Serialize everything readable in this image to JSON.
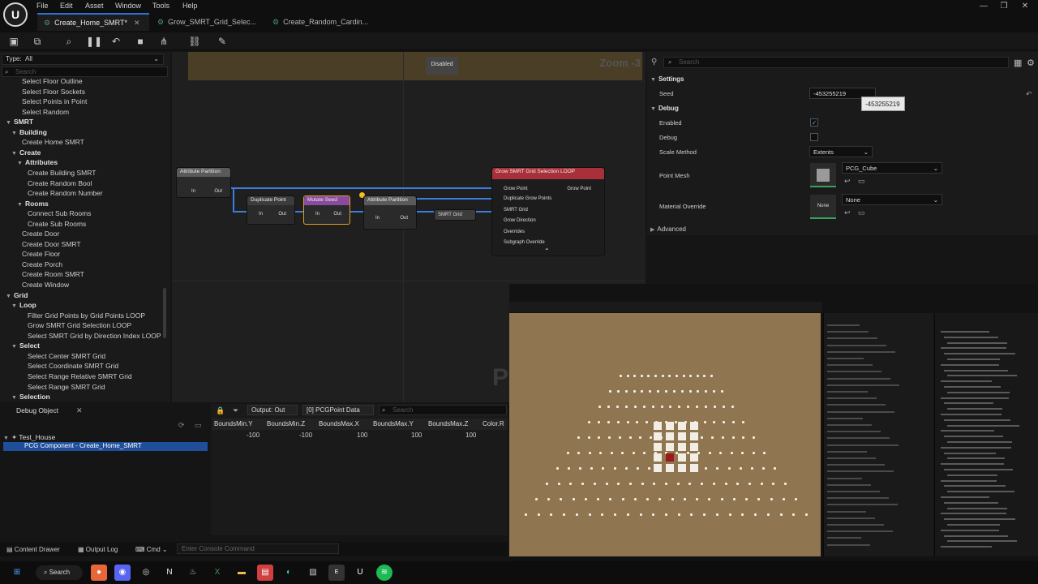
{
  "menu": [
    "File",
    "Edit",
    "Asset",
    "Window",
    "Tools",
    "Help"
  ],
  "tabs": [
    {
      "label": "Create_Home_SMRT*",
      "active": true
    },
    {
      "label": "Grow_SMRT_Grid_Selec..."
    },
    {
      "label": "Create_Random_Cardin..."
    }
  ],
  "left": {
    "type_label": "Type:",
    "type_value": "All",
    "search_placeholder": "Search",
    "items": [
      {
        "t": "Select Floor Outline",
        "lvl": 2
      },
      {
        "t": "Select Floor Sockets",
        "lvl": 2
      },
      {
        "t": "Select Points in Point",
        "lvl": 2
      },
      {
        "t": "Select Random",
        "lvl": 2
      },
      {
        "t": "SMRT",
        "lvl": 0,
        "h": true
      },
      {
        "t": "Building",
        "lvl": 1,
        "h": true
      },
      {
        "t": "Create Home SMRT",
        "lvl": 2
      },
      {
        "t": "Create",
        "lvl": 1,
        "h": true
      },
      {
        "t": "Attributes",
        "lvl": 2,
        "h": true
      },
      {
        "t": "Create Building SMRT",
        "lvl": 3
      },
      {
        "t": "Create Random Bool",
        "lvl": 3
      },
      {
        "t": "Create Random Number",
        "lvl": 3
      },
      {
        "t": "Rooms",
        "lvl": 2,
        "h": true
      },
      {
        "t": "Connect Sub Rooms",
        "lvl": 3
      },
      {
        "t": "Create Sub Rooms",
        "lvl": 3
      },
      {
        "t": "Create Door",
        "lvl": 2
      },
      {
        "t": "Create Door SMRT",
        "lvl": 2
      },
      {
        "t": "Create Floor",
        "lvl": 2
      },
      {
        "t": "Create Porch",
        "lvl": 2
      },
      {
        "t": "Create Room SMRT",
        "lvl": 2
      },
      {
        "t": "Create Window",
        "lvl": 2
      },
      {
        "t": "Grid",
        "lvl": 0,
        "h": true
      },
      {
        "t": "Loop",
        "lvl": 1,
        "h": true
      },
      {
        "t": "Filter Grid Points by Grid Points LOOP",
        "lvl": 3
      },
      {
        "t": "Grow SMRT Grid Selection LOOP",
        "lvl": 3
      },
      {
        "t": "Select SMRT Grid by Direction Index LOOP",
        "lvl": 3
      },
      {
        "t": "Select",
        "lvl": 1,
        "h": true
      },
      {
        "t": "Select Center SMRT Grid",
        "lvl": 3
      },
      {
        "t": "Select Coordinate SMRT Grid",
        "lvl": 3
      },
      {
        "t": "Select Range Relative SMRT Grid",
        "lvl": 3
      },
      {
        "t": "Select Range SMRT Grid",
        "lvl": 3
      },
      {
        "t": "Selection",
        "lvl": 1,
        "h": true
      }
    ]
  },
  "graph": {
    "zoom": "Zoom -3",
    "disabled_label": "Disabled",
    "nodes": {
      "attr1": "Attribute Partition",
      "dup": "Duplicate Point",
      "mutate": "Mutate Seed",
      "attr2": "Attribute Partition",
      "smrt": "SMRT Grid",
      "grow": "Grow SMRT Grid Selection LOOP",
      "pin_in": "In",
      "pin_out": "Out",
      "grow_pins": [
        "Grow Point",
        "Duplicate Grow Points",
        "SMRT Grid",
        "Grow Direction",
        "Overrides",
        "Subgraph Override"
      ],
      "grow_out": "Grow Point"
    }
  },
  "details": {
    "search_placeholder": "Search",
    "settings": "Settings",
    "seed_label": "Seed",
    "seed_value": "-453255219",
    "seed_tooltip": "-453255219",
    "debug_section": "Debug",
    "enabled": "Enabled",
    "debug": "Debug",
    "scale_method": "Scale Method",
    "scale_value": "Extents",
    "point_mesh": "Point Mesh",
    "mesh_value": "PCG_Cube",
    "material_override": "Material Override",
    "material_value": "None",
    "thumb_none": "None",
    "advanced": "Advanced"
  },
  "debug_object": {
    "title": "Debug Object",
    "house": "Test_House",
    "component": "PCG Component - Create_Home_SMRT"
  },
  "output": {
    "pin": "Output: Out",
    "data": "[0] PCGPoint Data",
    "search_placeholder": "Search",
    "columns": [
      "BoundsMin.Y",
      "BoundsMin.Z",
      "BoundsMax.X",
      "BoundsMax.Y",
      "BoundsMax.Z",
      "Color.R"
    ],
    "row": [
      "-100",
      "-100",
      "100",
      "100",
      "100",
      ""
    ]
  },
  "bottom": {
    "content_drawer": "Content Drawer",
    "output_log": "Output Log",
    "cmd": "Cmd",
    "console_placeholder": "Enter Console Command"
  },
  "taskbar": {
    "search": "Search"
  }
}
